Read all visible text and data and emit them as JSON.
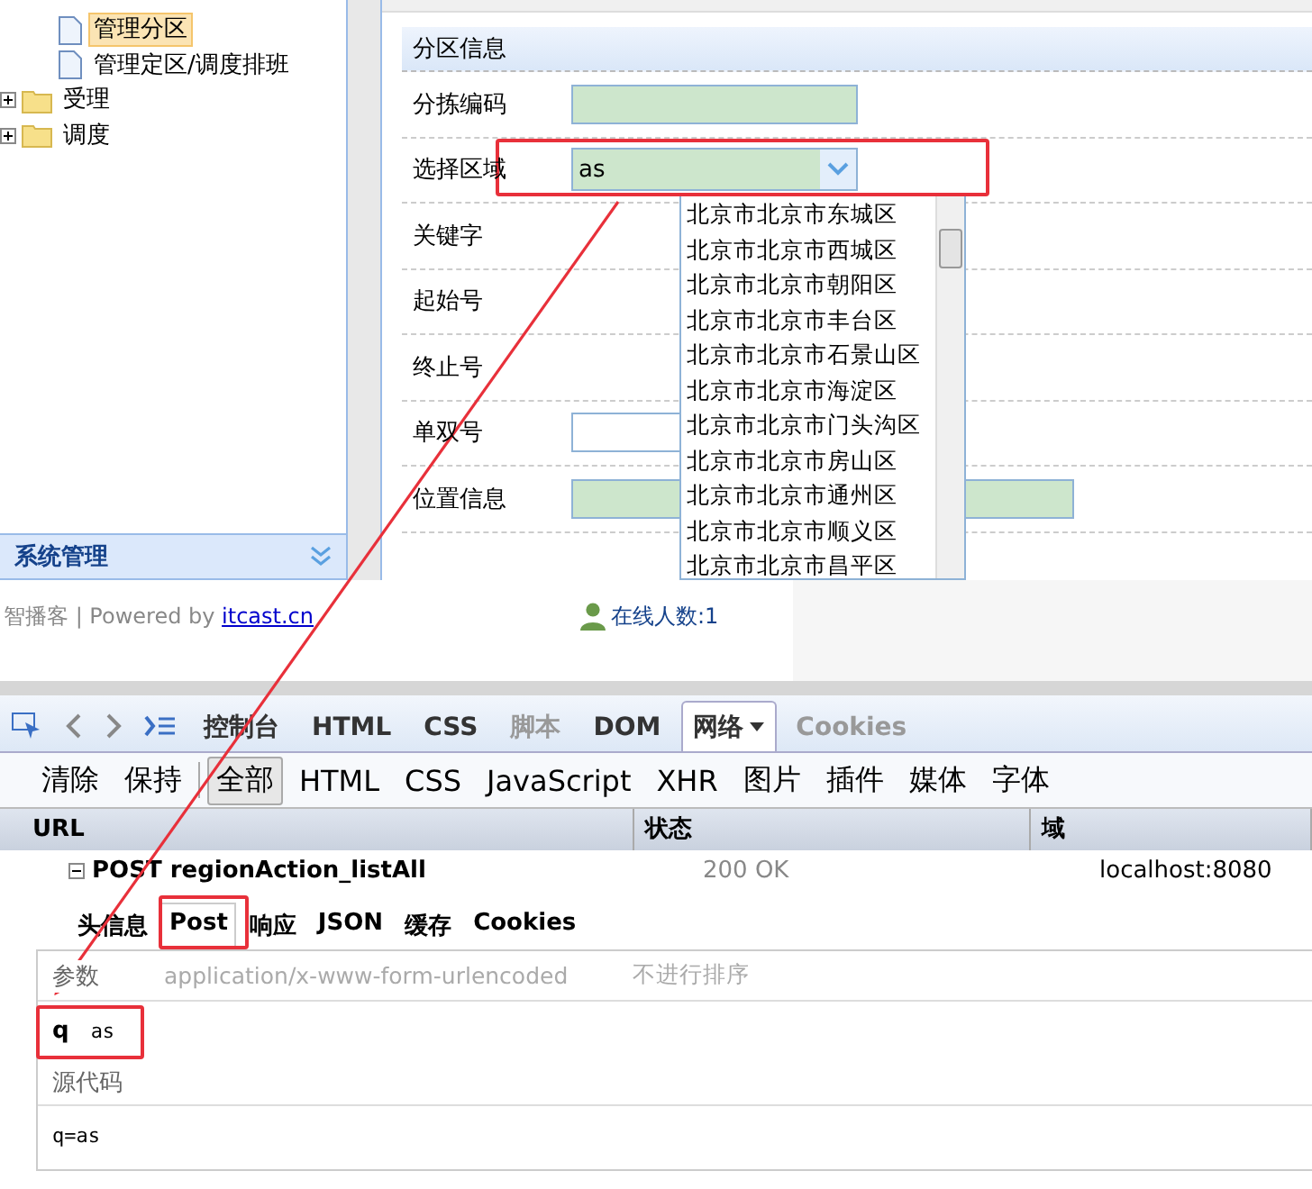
{
  "sidebar": {
    "tree": [
      {
        "label": "管理分区",
        "kind": "page",
        "selected": true
      },
      {
        "label": "管理定区/调度排班",
        "kind": "page",
        "selected": false
      },
      {
        "label": "受理",
        "kind": "folder",
        "selected": false
      },
      {
        "label": "调度",
        "kind": "folder",
        "selected": false
      }
    ],
    "accordion_header": "系统管理"
  },
  "form": {
    "title": "分区信息",
    "fields": [
      {
        "label": "分拣编码",
        "kind": "text"
      },
      {
        "label": "选择区域",
        "kind": "combo",
        "value": "as"
      },
      {
        "label": "关键字",
        "kind": "plain"
      },
      {
        "label": "起始号",
        "kind": "plain"
      },
      {
        "label": "终止号",
        "kind": "plain"
      },
      {
        "label": "单双号",
        "kind": "select"
      },
      {
        "label": "位置信息",
        "kind": "wide"
      }
    ],
    "dropdown_options": [
      "北京市北京市东城区",
      "北京市北京市西城区",
      "北京市北京市朝阳区",
      "北京市北京市丰台区",
      "北京市北京市石景山区",
      "北京市北京市海淀区",
      "北京市北京市门头沟区",
      "北京市北京市房山区",
      "北京市北京市通州区",
      "北京市北京市顺义区",
      "北京市北京市昌平区"
    ]
  },
  "footer": {
    "copyright": "智播客 | Powered by ",
    "link": "itcast.cn",
    "online": "在线人数:1"
  },
  "devtools": {
    "tabs": [
      {
        "label": "控制台",
        "selected": false,
        "disabled": false
      },
      {
        "label": "HTML",
        "selected": false,
        "disabled": false
      },
      {
        "label": "CSS",
        "selected": false,
        "disabled": false
      },
      {
        "label": "脚本",
        "selected": false,
        "disabled": true
      },
      {
        "label": "DOM",
        "selected": false,
        "disabled": false
      },
      {
        "label": "网络",
        "selected": true,
        "disabled": false
      },
      {
        "label": "Cookies",
        "selected": false,
        "disabled": true
      }
    ],
    "actions": [
      "清除",
      "保持"
    ],
    "filters": [
      {
        "label": "全部",
        "selected": true
      },
      {
        "label": "HTML",
        "selected": false
      },
      {
        "label": "CSS",
        "selected": false
      },
      {
        "label": "JavaScript",
        "selected": false
      },
      {
        "label": "XHR",
        "selected": false
      },
      {
        "label": "图片",
        "selected": false
      },
      {
        "label": "插件",
        "selected": false
      },
      {
        "label": "媒体",
        "selected": false
      },
      {
        "label": "字体",
        "selected": false
      }
    ],
    "columns": [
      "URL",
      "状态",
      "域"
    ],
    "request": {
      "url": "POST regionAction_listAll",
      "status": "200 OK",
      "domain": "localhost:8080",
      "expanded": true
    },
    "detail_tabs": [
      {
        "label": "头信息",
        "selected": false
      },
      {
        "label": "Post",
        "selected": true
      },
      {
        "label": "响应",
        "selected": false
      },
      {
        "label": "JSON",
        "selected": false
      },
      {
        "label": "缓存",
        "selected": false
      },
      {
        "label": "Cookies",
        "selected": false
      }
    ],
    "params_heading": "参数",
    "content_type": "application/x-www-form-urlencoded",
    "sort_toggle": "不进行排序",
    "params": [
      {
        "name": "q",
        "value": "as"
      }
    ],
    "source_heading": "源代码",
    "source": "q=as"
  }
}
